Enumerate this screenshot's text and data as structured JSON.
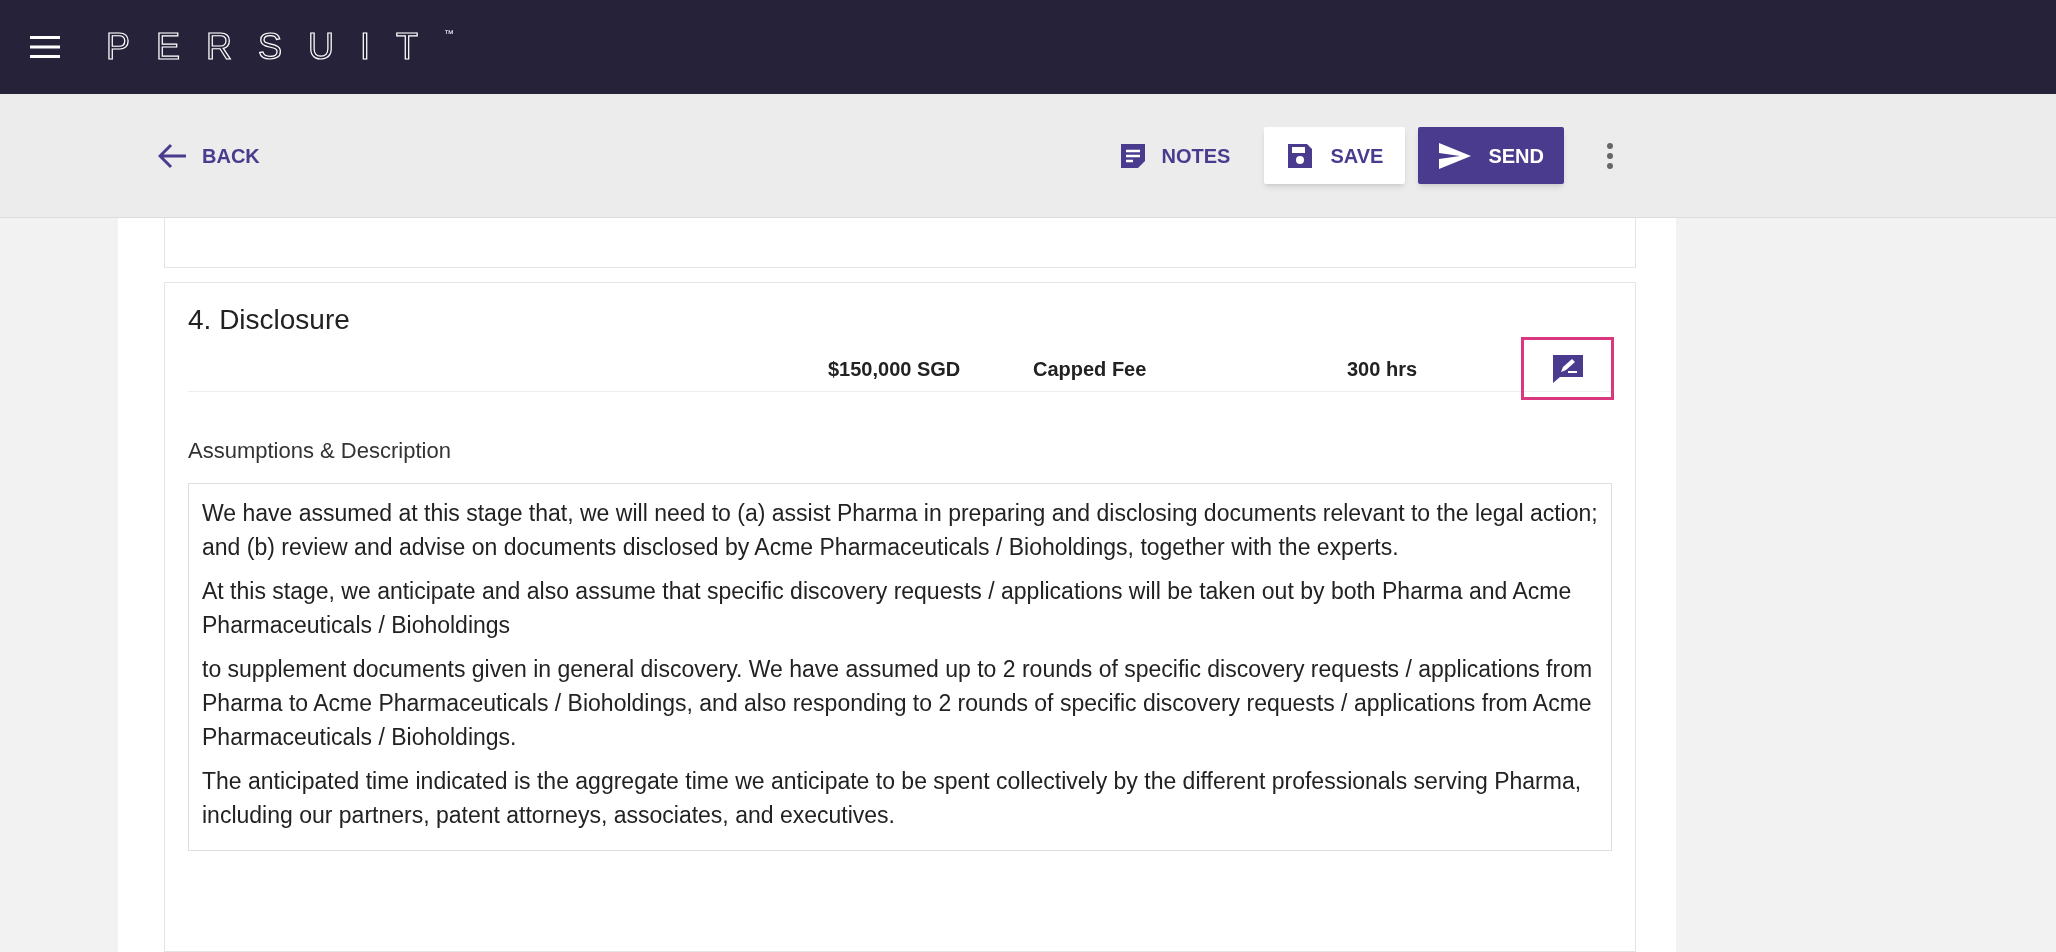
{
  "header": {
    "logo": "PERSUIT",
    "trademark": "™"
  },
  "toolbar": {
    "back": "BACK",
    "notes": "NOTES",
    "save": "SAVE",
    "send": "SEND"
  },
  "section": {
    "title": "4. Disclosure",
    "price": "$150,000 SGD",
    "fee_type": "Capped Fee",
    "hours": "300 hrs",
    "comment_highlighted": true,
    "description_label": "Assumptions & Description",
    "paragraphs": [
      "We have assumed at this stage that, we will need to (a) assist Pharma in preparing and disclosing documents relevant to the legal action; and (b) review and advise on documents disclosed by Acme Pharmaceuticals / Bioholdings, together with the experts.",
      "At this stage, we anticipate and also assume that specific discovery requests / applications will be taken out by both Pharma and Acme Pharmaceuticals / Bioholdings",
      "to supplement documents given in general discovery. We have assumed up to 2 rounds of specific discovery requests / applications from Pharma to Acme Pharmaceuticals / Bioholdings, and also responding to 2 rounds of specific discovery requests / applications from Acme Pharmaceuticals / Bioholdings.",
      "The anticipated time indicated is the aggregate time we anticipate to be spent collectively by the different professionals serving Pharma, including our partners, patent attorneys, associates, and executives."
    ]
  }
}
